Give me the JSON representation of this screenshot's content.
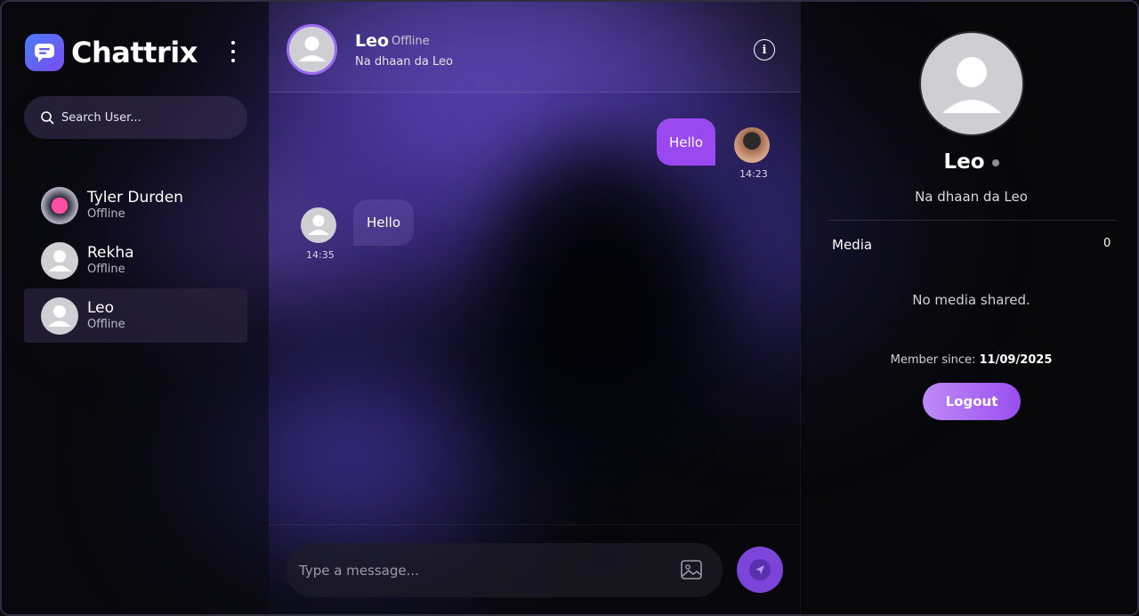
{
  "app": {
    "name": "Chattrix",
    "logo_icon": "chat-bubble-icon"
  },
  "colors": {
    "accent": "#9a48f0",
    "logout_gradient_start": "#c08af8",
    "logout_gradient_end": "#9a4ef0"
  },
  "sidebar": {
    "search_placeholder": "Search User...",
    "users": [
      {
        "name": "Tyler Durden",
        "status": "Offline",
        "active": false
      },
      {
        "name": "Rekha",
        "status": "Offline",
        "active": false
      },
      {
        "name": "Leo",
        "status": "Offline",
        "active": true
      }
    ]
  },
  "chat": {
    "header": {
      "name": "Leo",
      "status": "Offline",
      "bio": "Na dhaan da Leo"
    },
    "messages": [
      {
        "direction": "out",
        "text": "Hello",
        "time": "14:23"
      },
      {
        "direction": "in",
        "text": "Hello",
        "time": "14:35"
      }
    ],
    "composer_placeholder": "Type a message..."
  },
  "profile": {
    "name": "Leo",
    "bio": "Na dhaan da Leo",
    "media_label": "Media",
    "media_count": "0",
    "no_media": "No media shared.",
    "member_since_label": "Member since:",
    "member_since_date": "11/09/2025",
    "logout_label": "Logout"
  }
}
